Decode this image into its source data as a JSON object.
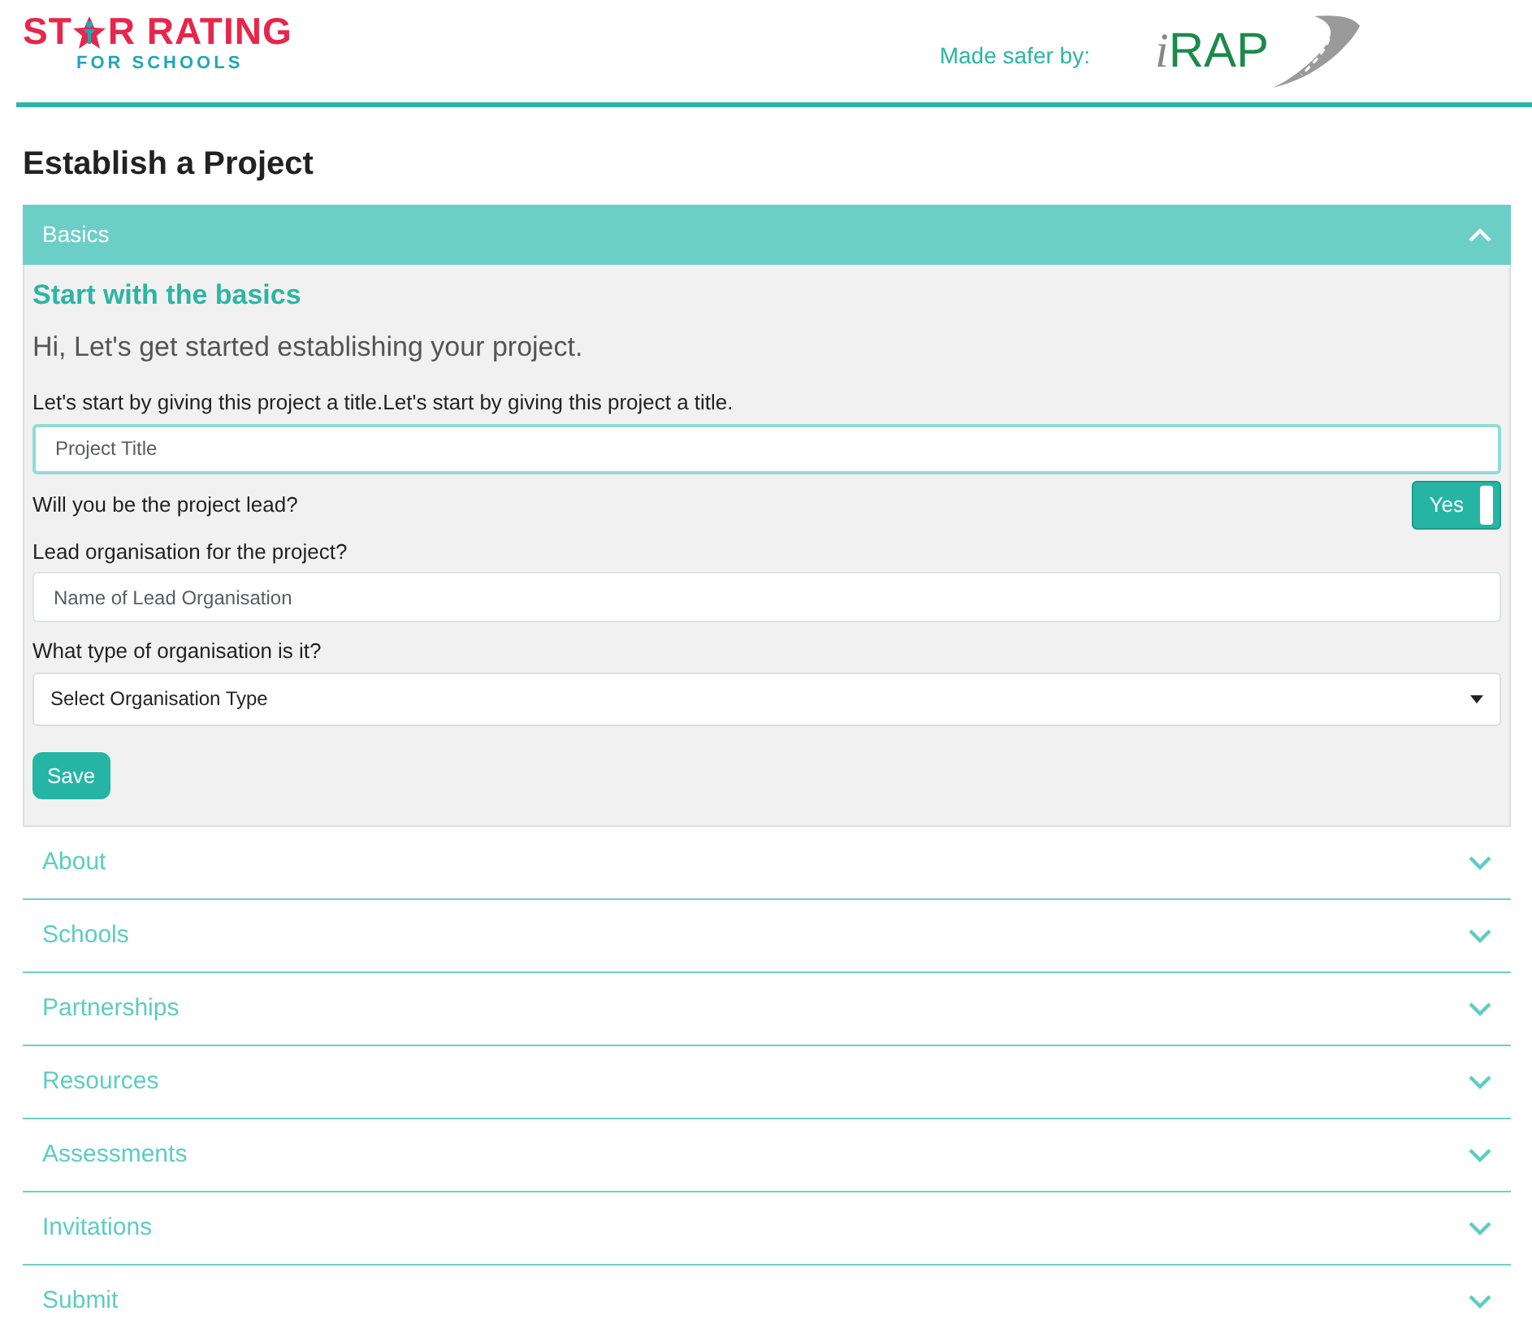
{
  "header": {
    "logo": {
      "before": "ST",
      "after": "R RATING",
      "subtitle": "FOR SCHOOLS"
    },
    "made_by": "Made safer by:",
    "partner_logo": {
      "prefix": "i",
      "name": "RAP"
    }
  },
  "page_title": "Establish a Project",
  "sections": [
    {
      "title": "Basics",
      "expanded": true,
      "content": {
        "heading": "Start with the basics",
        "intro": "Hi, Let's get started establishing your project.",
        "title_label": "Let's start by giving this project a title.Let's start by giving this project a title.",
        "title_placeholder": "Project Title",
        "lead_question": "Will you be the project lead?",
        "lead_toggle": {
          "label": "Yes",
          "on": true
        },
        "org_label": "Lead organisation for the project?",
        "org_placeholder": "Name of Lead Organisation",
        "type_label": "What type of organisation is it?",
        "type_value": "Select Organisation Type",
        "save": "Save"
      }
    },
    {
      "title": "About",
      "expanded": false
    },
    {
      "title": "Schools",
      "expanded": false
    },
    {
      "title": "Partnerships",
      "expanded": false
    },
    {
      "title": "Resources",
      "expanded": false
    },
    {
      "title": "Assessments",
      "expanded": false
    },
    {
      "title": "Invitations",
      "expanded": false
    },
    {
      "title": "Submit",
      "expanded": false
    }
  ]
}
